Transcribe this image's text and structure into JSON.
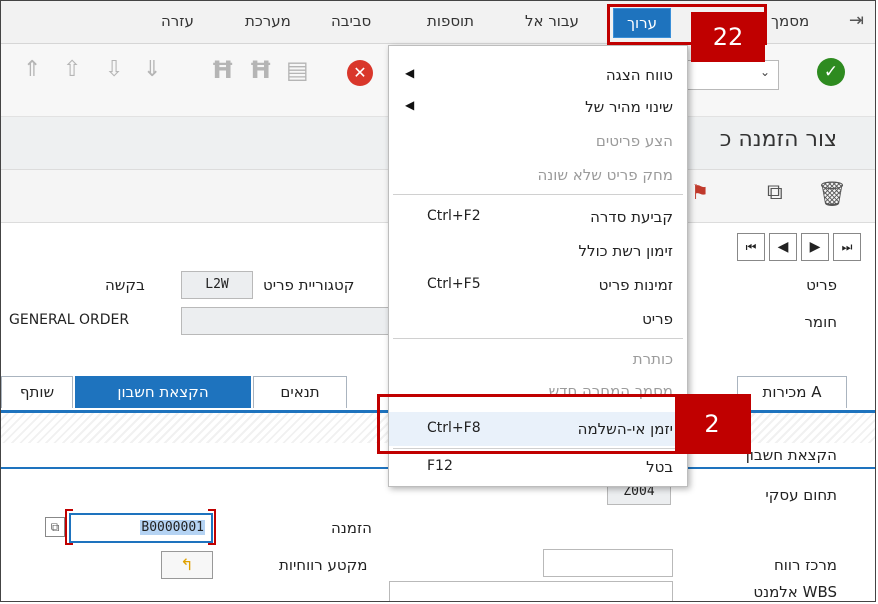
{
  "menubar": {
    "items": [
      "מסמך",
      "ערוך",
      "עבור אל",
      "תוספות",
      "סביבה",
      "מערכת",
      "עזרה"
    ],
    "active": "ערוך"
  },
  "header": {
    "title": "צור הזמנה כ"
  },
  "fields": {
    "item_label": "פריט",
    "material_label": "חומר",
    "item_category_label": "קטגוריית פריט",
    "item_category_value": "L2W",
    "request_label": "בקשה",
    "general_order": "GENERAL ORDER",
    "account_assignment_label": "הקצאת חשבון",
    "business_area_label": "תחום עסקי",
    "business_area_value": "Z004",
    "order_label": "הזמנה",
    "order_value": "B0000001",
    "profit_segment_label": "מקטע רווחיות",
    "profit_center_label": "מרכז רווח",
    "wbs_label": "אלמנט WBS"
  },
  "tabs": [
    "מכירות A",
    "תנאים",
    "הקצאת חשבון",
    "שותף"
  ],
  "active_tab": "הקצאת חשבון",
  "menu": {
    "items": [
      {
        "label": "טווח הצגה",
        "shortcut": "",
        "submenu": true,
        "disabled": false
      },
      {
        "label": "שינוי מהיר של",
        "shortcut": "",
        "submenu": true,
        "disabled": false
      },
      {
        "label": "הצע פריטים",
        "shortcut": "",
        "submenu": false,
        "disabled": true
      },
      {
        "label": "מחק פריט שלא שונה",
        "shortcut": "",
        "submenu": false,
        "disabled": true
      },
      {
        "label": "קביעת סדרה",
        "shortcut": "Ctrl+F2",
        "submenu": false,
        "disabled": false
      },
      {
        "label": "זימון רשת כולל",
        "shortcut": "",
        "submenu": false,
        "disabled": false
      },
      {
        "label": "זמינות פריט",
        "shortcut": "Ctrl+F5",
        "submenu": false,
        "disabled": false
      },
      {
        "label": "פריט",
        "shortcut": "",
        "submenu": false,
        "disabled": false
      },
      {
        "label": "כותרת",
        "shortcut": "",
        "submenu": false,
        "disabled": true
      },
      {
        "label": "מסמך המחרה חדש",
        "shortcut": "",
        "submenu": false,
        "disabled": true
      },
      {
        "label": "יזמן אי-השלמה",
        "shortcut": "Ctrl+F8",
        "submenu": false,
        "disabled": false
      },
      {
        "label": "בטל",
        "shortcut": "F12",
        "submenu": false,
        "disabled": false
      }
    ]
  },
  "callouts": {
    "menu_step": "22",
    "item_step": "2"
  },
  "colors": {
    "accent": "#1e73be",
    "callout": "#c00000",
    "confirm": "#2e8b20",
    "cancel": "#d9372b"
  }
}
